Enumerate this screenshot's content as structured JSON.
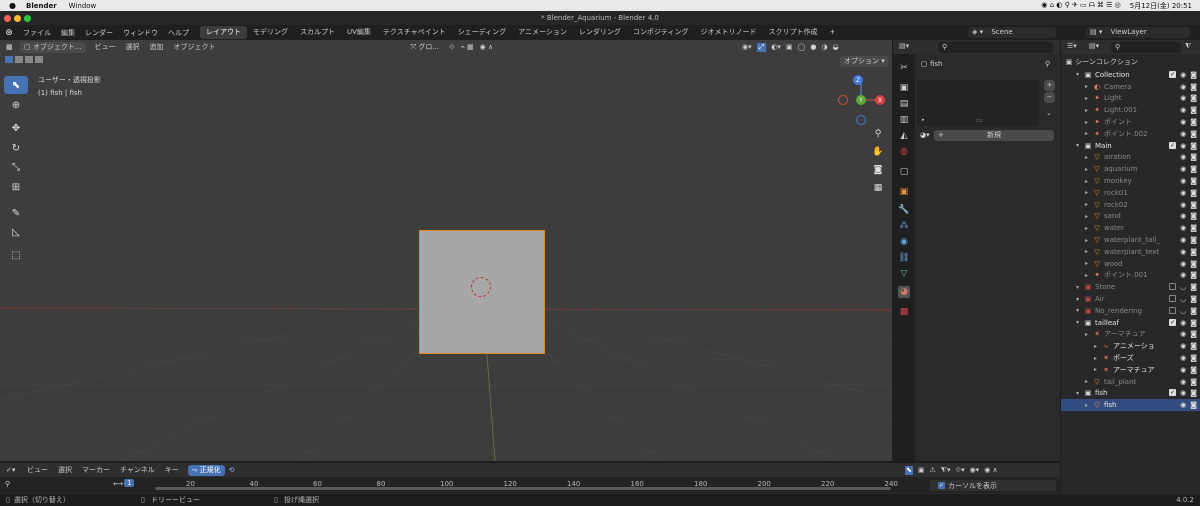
{
  "macos_menubar": {
    "app_name": "Blender",
    "menus": [
      "Window"
    ],
    "datetime": "5月12日(金) 20:51"
  },
  "window_title": "* Blender_Aquarium - Blender 4.0",
  "topbar": {
    "menus": [
      "ファイル",
      "編集",
      "レンダー",
      "ウィンドウ",
      "ヘルプ"
    ],
    "workspaces": [
      "レイアウト",
      "モデリング",
      "スカルプト",
      "UV編集",
      "テクスチャペイント",
      "シェーディング",
      "アニメーション",
      "レンダリング",
      "コンポジティング",
      "ジオメトリノード",
      "スクリプト作成"
    ],
    "add_workspace": "+",
    "scene": "Scene",
    "view_layer": "ViewLayer"
  },
  "viewport": {
    "mode": "オブジェクト...",
    "menus": [
      "ビュー",
      "選択",
      "追加",
      "オブジェクト"
    ],
    "transform_orientation": "グロ...",
    "options_label": "オプション",
    "overlay_line1": "ユーザー・透視投影",
    "overlay_line2": "(1) fish | fish",
    "gizmo": {
      "z": "Z",
      "y": "Y",
      "x": "X"
    }
  },
  "properties": {
    "object_name": "fish",
    "new_button": "新規"
  },
  "outliner": {
    "title": "シーンコレクション",
    "rows": [
      {
        "label": "Collection",
        "indent": 1,
        "icon": "▣",
        "kind": "coll",
        "checkbox": true
      },
      {
        "label": "Camera",
        "indent": 2,
        "icon": "◐",
        "kind": "dim"
      },
      {
        "label": "Light",
        "indent": 2,
        "icon": "✦",
        "kind": "dim"
      },
      {
        "label": "Light.001",
        "indent": 2,
        "icon": "✦",
        "kind": "dim"
      },
      {
        "label": "ポイント",
        "indent": 2,
        "icon": "✦",
        "kind": "dim"
      },
      {
        "label": "ポイント.002",
        "indent": 2,
        "icon": "✦",
        "kind": "dim"
      },
      {
        "label": "Main",
        "indent": 1,
        "icon": "▣",
        "kind": "coll",
        "checkbox": true
      },
      {
        "label": "airation",
        "indent": 2,
        "icon": "▽",
        "kind": "dim"
      },
      {
        "label": "aquarium",
        "indent": 2,
        "icon": "▽",
        "kind": "dim"
      },
      {
        "label": "monkey",
        "indent": 2,
        "icon": "▽",
        "kind": "dim"
      },
      {
        "label": "rock01",
        "indent": 2,
        "icon": "▽",
        "kind": "dim"
      },
      {
        "label": "rock02",
        "indent": 2,
        "icon": "▽",
        "kind": "dim"
      },
      {
        "label": "sand",
        "indent": 2,
        "icon": "▽",
        "kind": "dim"
      },
      {
        "label": "water",
        "indent": 2,
        "icon": "▽",
        "kind": "dim"
      },
      {
        "label": "waterplant_tall_",
        "indent": 2,
        "icon": "▽",
        "kind": "dim"
      },
      {
        "label": "waterplant_text",
        "indent": 2,
        "icon": "▽",
        "kind": "dim"
      },
      {
        "label": "wood",
        "indent": 2,
        "icon": "▽",
        "kind": "dim"
      },
      {
        "label": "ポイント.001",
        "indent": 2,
        "icon": "✦",
        "kind": "dim"
      },
      {
        "label": "Stone",
        "indent": 1,
        "icon": "▣",
        "kind": "dimcoll"
      },
      {
        "label": "Air",
        "indent": 1,
        "icon": "▣",
        "kind": "dimcoll"
      },
      {
        "label": "No_rendering",
        "indent": 1,
        "icon": "▣",
        "kind": "dimcoll"
      },
      {
        "label": "tailleaf",
        "indent": 1,
        "icon": "▣",
        "kind": "coll",
        "checkbox": true
      },
      {
        "label": "アーマチュア",
        "indent": 2,
        "icon": "✶",
        "kind": "dim"
      },
      {
        "label": "アニメーショ",
        "indent": 3,
        "icon": "⤷",
        "kind": "white"
      },
      {
        "label": "ポーズ",
        "indent": 3,
        "icon": "✶",
        "kind": "white"
      },
      {
        "label": "アーマチュア",
        "indent": 3,
        "icon": "✶",
        "kind": "white"
      },
      {
        "label": "tail_plant",
        "indent": 2,
        "icon": "▽",
        "kind": "dim"
      },
      {
        "label": "fish",
        "indent": 1,
        "icon": "▣",
        "kind": "coll",
        "checkbox": true
      },
      {
        "label": "fish",
        "indent": 2,
        "icon": "▽",
        "kind": "selected"
      }
    ]
  },
  "timeline": {
    "menus": [
      "ビュー",
      "選択",
      "マーカー",
      "チャンネル",
      "キー"
    ],
    "normalize": "正規化",
    "current_frame": "1",
    "ticks": [
      "20",
      "40",
      "60",
      "80",
      "100",
      "120",
      "140",
      "160",
      "180",
      "200",
      "220",
      "240"
    ],
    "show_cursor": "カーソルを表示"
  },
  "statusbar": {
    "items": [
      "選択（切り替え）",
      "ドリーービュー",
      "投げ縄選択"
    ],
    "version": "4.0.2"
  }
}
